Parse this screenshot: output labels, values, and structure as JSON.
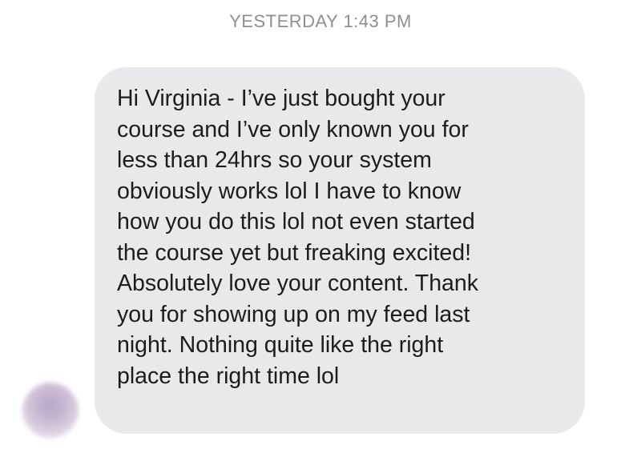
{
  "conversation": {
    "timestamp": "YESTERDAY 1:43 PM",
    "message": {
      "text": "Hi Virginia - I’ve just bought your\ncourse and I’ve only known you for\nless than 24hrs so your system\nobviously works lol I have to know\nhow you do this lol not even started\nthe course yet but freaking excited!\nAbsolutely love your content. Thank\nyou for showing up on my feed last\nnight. Nothing quite like the right\nplace the right time lol"
    },
    "sender": {
      "avatar_icon": "blurred-profile-avatar"
    }
  }
}
